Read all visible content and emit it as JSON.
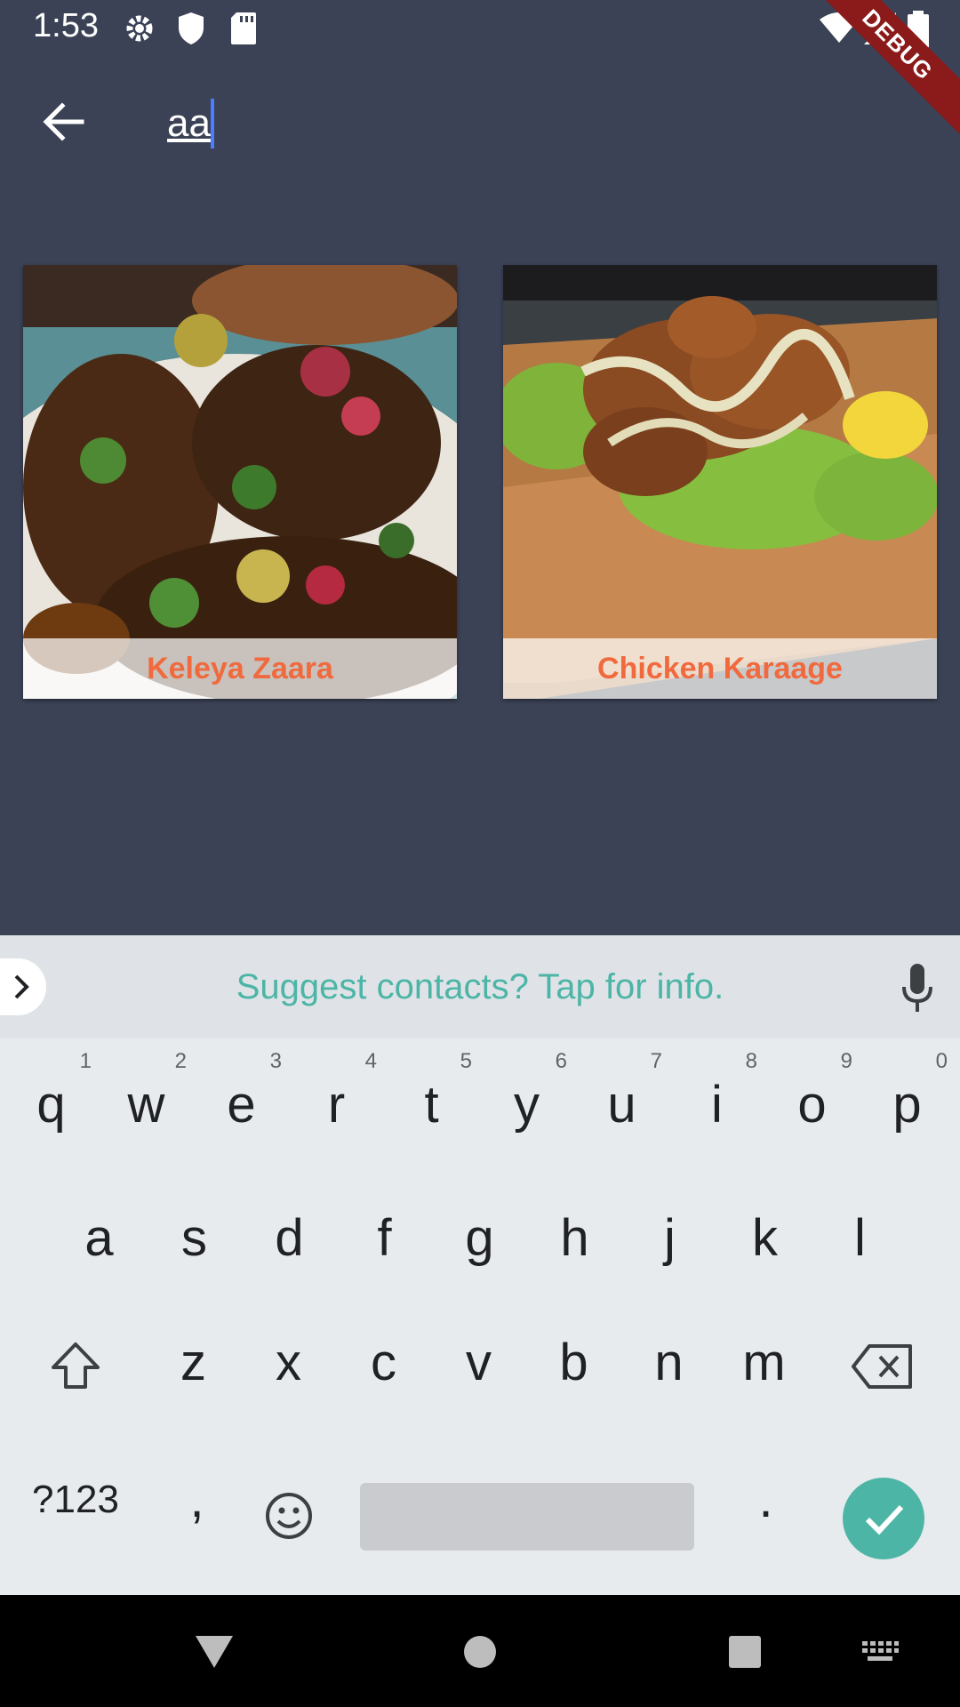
{
  "status_bar": {
    "time": "1:53"
  },
  "debug_ribbon": "DEBUG",
  "search": {
    "value": "aa"
  },
  "results": [
    {
      "title": "Keleya Zaara"
    },
    {
      "title": "Chicken Karaage"
    }
  ],
  "keyboard": {
    "suggestion": "Suggest contacts? Tap for info.",
    "row1": [
      {
        "key": "q",
        "hint": "1"
      },
      {
        "key": "w",
        "hint": "2"
      },
      {
        "key": "e",
        "hint": "3"
      },
      {
        "key": "r",
        "hint": "4"
      },
      {
        "key": "t",
        "hint": "5"
      },
      {
        "key": "y",
        "hint": "6"
      },
      {
        "key": "u",
        "hint": "7"
      },
      {
        "key": "i",
        "hint": "8"
      },
      {
        "key": "o",
        "hint": "9"
      },
      {
        "key": "p",
        "hint": "0"
      }
    ],
    "row2": [
      "a",
      "s",
      "d",
      "f",
      "g",
      "h",
      "j",
      "k",
      "l"
    ],
    "row3": [
      "z",
      "x",
      "c",
      "v",
      "b",
      "n",
      "m"
    ],
    "symbols_label": "?123",
    "comma": ",",
    "period": "."
  },
  "colors": {
    "background": "#3b4256",
    "card_label": "#f06a3d",
    "accent": "#4cb5a6"
  }
}
